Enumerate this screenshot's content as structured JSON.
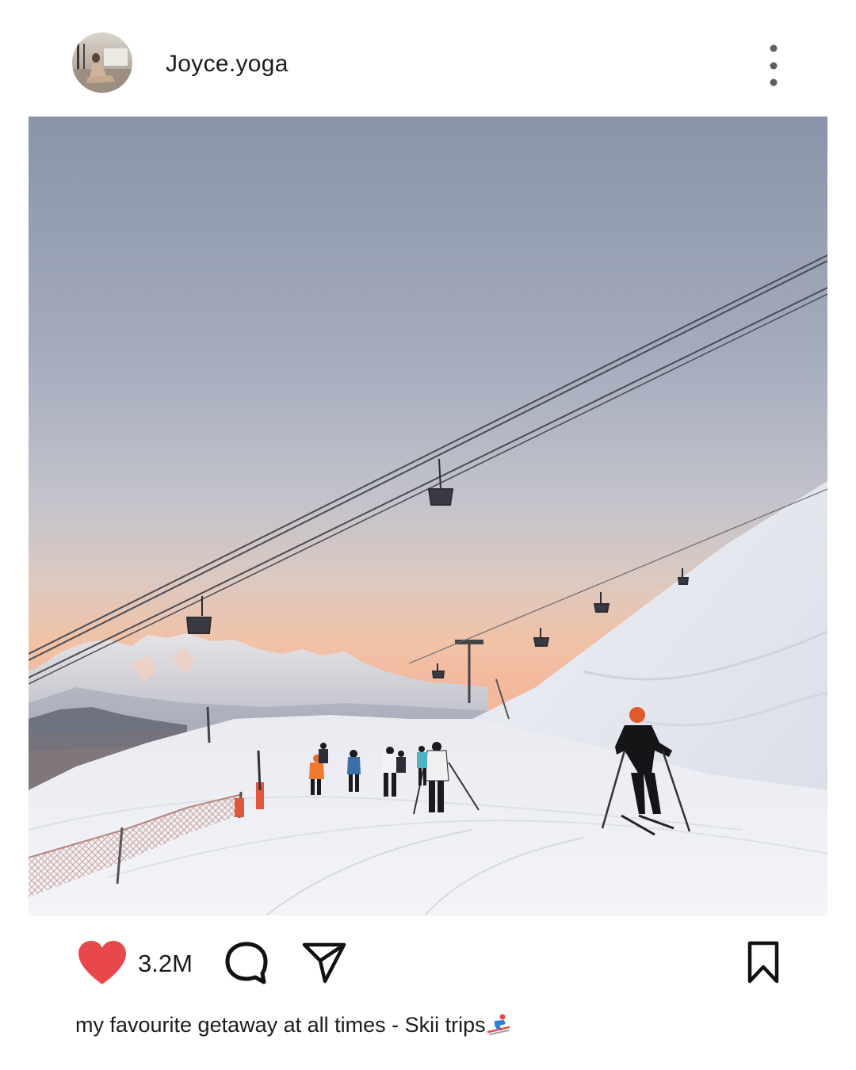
{
  "post": {
    "username": "Joyce.yoga",
    "avatar_icon": "profile-photo",
    "more_icon": "vertical-dots-icon",
    "photo_alt": "Skiers on a snowy slope beneath a chairlift at sunset",
    "actions": {
      "like_icon": "heart-icon",
      "like_color": "#e8484b",
      "liked": true,
      "like_count": "3.2M",
      "comment_icon": "comment-bubble-icon",
      "share_icon": "paper-plane-icon",
      "save_icon": "bookmark-icon"
    },
    "caption": {
      "text": "my favourite getaway at all times - Skii trips",
      "emoji_icon": "skier-emoji-icon"
    }
  }
}
